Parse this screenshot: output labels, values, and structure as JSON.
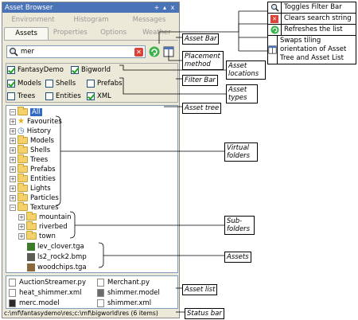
{
  "window": {
    "title": "Asset Browser",
    "pin": "+",
    "up": "▴",
    "close": "x"
  },
  "tabs_top": [
    "Environment",
    "Histogram",
    "Messages"
  ],
  "tabs_bottom": [
    "Assets",
    "Properties",
    "Options",
    "Weather"
  ],
  "search": {
    "value": "mer"
  },
  "locations": [
    {
      "label": "FantasyDemo",
      "checked": true
    },
    {
      "label": "Bigworld",
      "checked": true
    }
  ],
  "types": [
    {
      "label": "Models",
      "checked": true
    },
    {
      "label": "Shells",
      "checked": false
    },
    {
      "label": "Prefabs",
      "checked": false
    },
    {
      "label": "Trees",
      "checked": false
    },
    {
      "label": "Entities",
      "checked": false
    },
    {
      "label": "XML",
      "checked": true
    }
  ],
  "tree": {
    "all": "All",
    "items": [
      "Favourites",
      "History",
      "Models",
      "Shells",
      "Trees",
      "Prefabs",
      "Entities",
      "Lights",
      "Particles",
      "Textures"
    ],
    "subfolders": [
      "mountain",
      "riverbed",
      "town"
    ],
    "assets": [
      "lev_clover.tga",
      "ls2_rock2.bmp",
      "woodchips.tga"
    ]
  },
  "asset_list": [
    "AuctionStreamer.py",
    "Merchant.py",
    "heat_shimmer.xml",
    "shimmer.model",
    "merc.model",
    "shimmer.xml"
  ],
  "status": "c:\\mf\\fantasydemo\\res;c:\\mf\\bigworld\\res (6 items)",
  "callouts": {
    "asset_bar": "Asset Bar",
    "placement": "Placement method",
    "locations": "Asset locations",
    "filter_bar": "Filter Bar",
    "types": "Asset types",
    "tree": "Asset tree",
    "virtual": "Virtual folders",
    "sub": "Sub-folders",
    "assets": "Assets",
    "list": "Asset list",
    "status": "Status bar"
  },
  "legend": [
    {
      "icon": "magnifier-icon",
      "text": "Toggles Filter Bar"
    },
    {
      "icon": "clear-icon",
      "text": "Clears search string"
    },
    {
      "icon": "refresh-icon",
      "text": "Refreshes the list"
    },
    {
      "icon": "swap-layout-icon",
      "text": "Swaps tiling orientation of Asset Tree and Asset List"
    }
  ]
}
